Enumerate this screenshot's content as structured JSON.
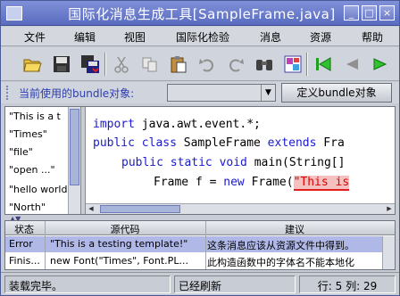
{
  "window": {
    "title": "国际化消息生成工具[SampleFrame.java]",
    "buttons": {
      "minimize": "_",
      "maximize": "□",
      "close": "×"
    }
  },
  "menu": [
    "文件",
    "编辑",
    "视图",
    "国际化检验",
    "消息",
    "资源",
    "帮助"
  ],
  "toolbar": {
    "icons": [
      "open-folder-icon",
      "save-icon",
      "save-all-icon",
      "cut-icon",
      "copy-icon",
      "paste-icon",
      "undo-icon",
      "redo-icon",
      "find-icon",
      "i18n-tool-icon",
      "first-icon",
      "previous-icon",
      "next-icon"
    ]
  },
  "bundle": {
    "label": "当前使用的bundle对象:",
    "selected": "",
    "define_button": "定义bundle对象"
  },
  "string_list": [
    "\"This is a t",
    "\"Times\"",
    "\"file\"",
    "\"open ...\"",
    "\"hello world",
    "\"North\""
  ],
  "code_lines": [
    {
      "kind": "import",
      "kw": "import",
      "text": " java.awt.event.*;"
    },
    {
      "kind": "class",
      "kw1": "public class",
      "text1": " SampleFrame ",
      "kw2": "extends",
      "text2": " Fra"
    },
    {
      "kind": "method",
      "kw": "public static void",
      "text": " main(String[]"
    },
    {
      "kind": "new",
      "text1": "Frame f = ",
      "kw": "new",
      "text2": " Frame(",
      "str": "\"This is"
    }
  ],
  "table": {
    "headers": [
      "状态",
      "源代码",
      "建议"
    ],
    "rows": [
      {
        "status": "Error",
        "source": "\"This is a testing template!\"",
        "advice": "这条消息应该从资源文件中得到。",
        "selected": true
      },
      {
        "status": "Finis...",
        "source": "new Font(\"Times\", Font.PL...",
        "advice": "此构造函数中的字体名不能本地化",
        "selected": false
      }
    ]
  },
  "status": {
    "left": "装载完毕。",
    "middle": "已经刷新",
    "right": "行: 5 列: 29"
  },
  "colors": {
    "accent": "#5a6cc0",
    "selection": "#b0b8e8",
    "keyword": "#1a1ad0",
    "string": "#e00000"
  }
}
